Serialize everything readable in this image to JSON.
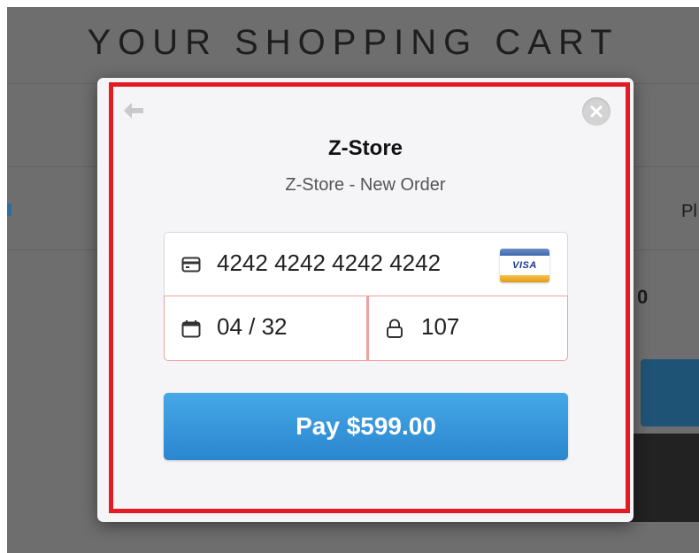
{
  "background_page": {
    "title": "YOUR SHOPPING CART",
    "column_header_fragment": "Pl",
    "price_fragment": "0"
  },
  "checkout": {
    "store_name": "Z-Store",
    "description": "Z-Store - New Order",
    "card_number": "4242 4242 4242 4242",
    "card_brand": "VISA",
    "expiry": "04 / 32",
    "cvc": "107",
    "pay_label": "Pay $599.00",
    "icons": {
      "back": "back-arrow-icon",
      "close": "close-icon",
      "card": "credit-card-icon",
      "calendar": "calendar-icon",
      "lock": "lock-icon"
    }
  },
  "colors": {
    "pay_button": "#3296db",
    "highlight_border": "#e31c23",
    "invalid_field_border": "#f3a0a0",
    "overlay": "#6e6e6e"
  }
}
